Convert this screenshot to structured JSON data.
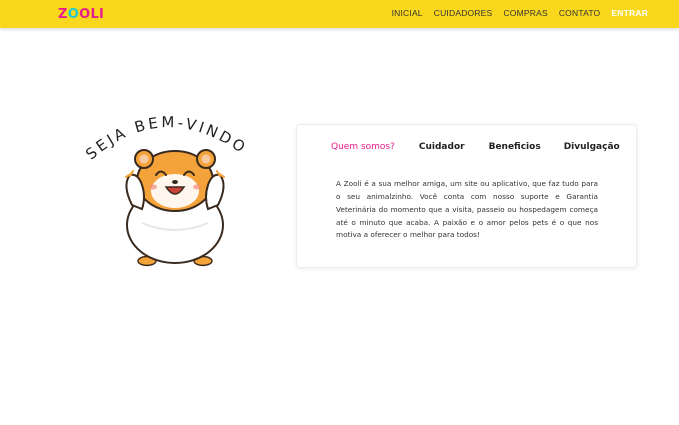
{
  "app": {
    "logo": {
      "text": "ZOOLI",
      "letters": [
        "Z",
        "O",
        "O",
        "L",
        "I"
      ],
      "colors": [
        "#e91e8c",
        "#1ec9d6",
        "#e91e8c",
        "#e91e8c",
        "#e91e8c"
      ]
    }
  },
  "nav": {
    "links": [
      {
        "label": "INICIAL",
        "active": false
      },
      {
        "label": "CUIDADORES",
        "active": false
      },
      {
        "label": "COMPRAS",
        "active": false
      },
      {
        "label": "CONTATO",
        "active": false
      },
      {
        "label": "ENTRAR",
        "active": true
      }
    ]
  },
  "hero": {
    "welcome_text": "SEJA BEM-VINDO",
    "mascot_icon": "hamster-mascot-icon"
  },
  "info_card": {
    "tabs": [
      {
        "label": "Quem somos?",
        "active": true
      },
      {
        "label": "Cuidador",
        "active": false
      },
      {
        "label": "Beneficios",
        "active": false
      },
      {
        "label": "Divulgação",
        "active": false
      }
    ],
    "content": "A Zooli é a sua melhor amiga, um site ou aplicativo, que faz tudo para o seu animalzinho. Você conta com nosso suporte e Garantia Veterinária do momento que a visita, passeio ou hospedagem começa até o minuto que acaba. A paixão e o amor pelos pets é o que nos motiva a oferecer o melhor para todos!"
  },
  "colors": {
    "navbar_bg": "#f9d71c",
    "accent_pink": "#e91e8c",
    "accent_cyan": "#1ec9d6",
    "hamster_orange": "#f4a23a"
  }
}
